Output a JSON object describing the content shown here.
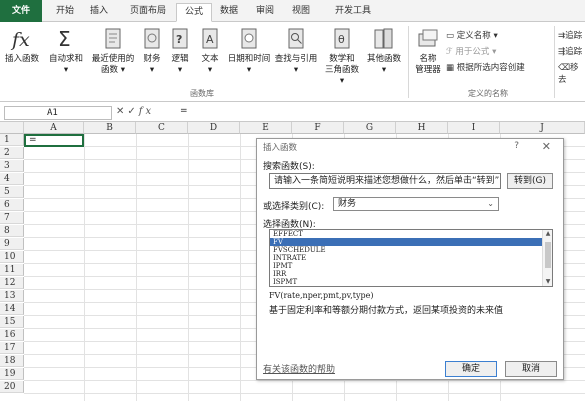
{
  "tabs": [
    "文件",
    "开始",
    "插入",
    "页面布局",
    "公式",
    "数据",
    "审阅",
    "视图",
    "开发工具"
  ],
  "active_tab": "公式",
  "ribbon": {
    "insert_function": "插入函数",
    "autosum": "自动求和",
    "recent": "最近使用的",
    "recent2": "函数",
    "financial": "财务",
    "logical": "逻辑",
    "text": "文本",
    "datetime": "日期和时间",
    "lookup": "查找与引用",
    "math": "数学和",
    "math2": "三角函数",
    "more": "其他函数",
    "group_library": "函数库",
    "name_manager": "名称",
    "name_manager2": "管理器",
    "define_name": "定义名称",
    "use_in_formula": "用于公式",
    "create_from_selection": "根据所选内容创建",
    "group_names": "定义的名称",
    "trace_precedents": "追踪",
    "trace_dependents": "追踪",
    "remove_arrows": "移去"
  },
  "formula_bar": {
    "name_box": "A1",
    "formula": "="
  },
  "grid": {
    "columns": [
      "A",
      "B",
      "C",
      "D",
      "E",
      "F",
      "G",
      "H",
      "I",
      "J"
    ],
    "rows": [
      "1",
      "2",
      "3",
      "4",
      "5",
      "6",
      "7",
      "8",
      "9",
      "10",
      "11",
      "12",
      "13",
      "14",
      "15",
      "16",
      "17",
      "18",
      "19",
      "20"
    ],
    "a1_value": "="
  },
  "dialog": {
    "title": "插入函数",
    "help": "?",
    "close": "✕",
    "search_label": "搜索函数(S):",
    "search_text": "请输入一条简短说明来描述您想做什么，然后单击“转到”",
    "go_button": "转到(G)",
    "category_label": "或选择类别(C):",
    "category_value": "财务",
    "select_label": "选择函数(N):",
    "functions": [
      "EFFECT",
      "FV",
      "FVSCHEDULE",
      "INTRATE",
      "IPMT",
      "IRR",
      "ISPMT"
    ],
    "selected_function": "FV",
    "syntax": "FV(rate,nper,pmt,pv,type)",
    "description": "基于固定利率和等额分期付款方式，返回某项投资的未来值",
    "help_link": "有关该函数的帮助",
    "ok": "确定",
    "cancel": "取消"
  }
}
